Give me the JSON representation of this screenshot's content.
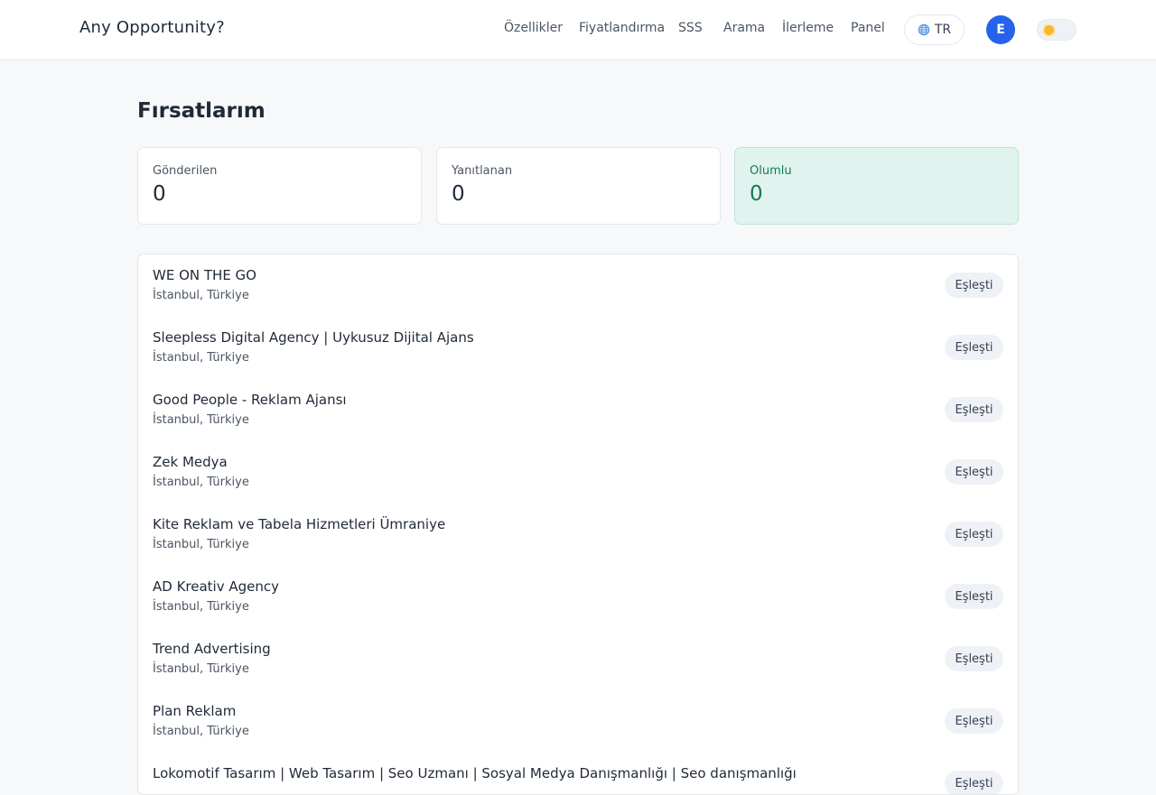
{
  "header": {
    "brand": "Any Opportunity?",
    "nav": [
      {
        "label": "Özellikler"
      },
      {
        "label": "Fiyatlandırma"
      },
      {
        "label": "SSS"
      },
      {
        "label": "Arama"
      },
      {
        "label": "İlerleme"
      },
      {
        "label": "Panel"
      }
    ],
    "language": "TR",
    "avatar_initial": "E"
  },
  "page": {
    "title": "Fırsatlarım"
  },
  "stats": [
    {
      "label": "Gönderilen",
      "value": "0"
    },
    {
      "label": "Yanıtlanan",
      "value": "0"
    },
    {
      "label": "Olumlu",
      "value": "0"
    }
  ],
  "opportunities": [
    {
      "name": "WE ON THE GO",
      "location": "İstanbul, Türkiye",
      "status": "Eşleşti"
    },
    {
      "name": "Sleepless Digital Agency | Uykusuz Dijital Ajans",
      "location": "İstanbul, Türkiye",
      "status": "Eşleşti"
    },
    {
      "name": "Good People - Reklam Ajansı",
      "location": "İstanbul, Türkiye",
      "status": "Eşleşti"
    },
    {
      "name": "Zek Medya",
      "location": "İstanbul, Türkiye",
      "status": "Eşleşti"
    },
    {
      "name": "Kite Reklam ve Tabela Hizmetleri Ümraniye",
      "location": "İstanbul, Türkiye",
      "status": "Eşleşti"
    },
    {
      "name": "AD Kreativ Agency",
      "location": "İstanbul, Türkiye",
      "status": "Eşleşti"
    },
    {
      "name": "Trend Advertising",
      "location": "İstanbul, Türkiye",
      "status": "Eşleşti"
    },
    {
      "name": "Plan Reklam",
      "location": "İstanbul, Türkiye",
      "status": "Eşleşti"
    },
    {
      "name": "Lokomotif Tasarım | Web Tasarım | Seo Uzmanı | Sosyal Medya Danışmanlığı | Seo danışmanlığı",
      "location": "",
      "status": "Eşleşti"
    }
  ],
  "colors": {
    "accent": "#2563eb",
    "positive_bg": "#e1f3ee",
    "positive_text": "#127a56",
    "badge_bg": "#eef1f5",
    "toggle_sun": "#f5b82e"
  }
}
